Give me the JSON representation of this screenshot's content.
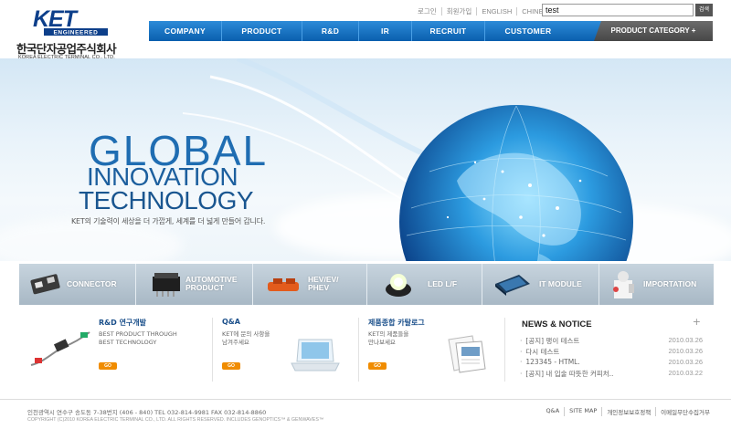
{
  "logo": {
    "mark_text": "KET",
    "mark_sub": "ENGINEERED",
    "company_ko": "한국단자공업주식회사",
    "company_en": "KOREA ELECTRIC TERMINAL CO., LTD."
  },
  "util_links": [
    "로그인",
    "회원가입",
    "ENGLISH",
    "CHINESE"
  ],
  "search": {
    "value": "test",
    "button": "검색"
  },
  "gnb": {
    "items": [
      "COMPANY",
      "PRODUCT",
      "R&D",
      "IR",
      "RECRUIT",
      "CUSTOMER"
    ],
    "product_category": "PRODUCT CATEGORY +"
  },
  "hero": {
    "line1": "GLOBAL",
    "line2": "INNOVATION",
    "line3": "TECHNOLOGY",
    "subtitle": "KET의 기술력이 세상을 더 가깝게, 세계를 더 넓게 만들어 갑니다."
  },
  "categories": [
    {
      "label": "CONNECTOR"
    },
    {
      "label": "AUTOMOTIVE",
      "label2": "PRODUCT"
    },
    {
      "label": "HEV/EV/",
      "label2": "PHEV"
    },
    {
      "label": "LED L/F"
    },
    {
      "label": "IT MODULE"
    },
    {
      "label": "IMPORTATION"
    }
  ],
  "boxes": {
    "rnd": {
      "title": "R&D 연구개발",
      "desc1": "BEST PRODUCT THROUGH",
      "desc2": "BEST TECHNOLOGY",
      "go": "GO"
    },
    "qna": {
      "title": "Q&A",
      "desc1": "KET에 문의 사항을",
      "desc2": "남겨주세요",
      "go": "GO"
    },
    "catalog": {
      "title": "제품종합 카탈로그",
      "desc1": "KET의 제품들을",
      "desc2": "만나보세요",
      "go": "GO"
    }
  },
  "news": {
    "title": "NEWS & NOTICE",
    "more": "+",
    "items": [
      {
        "text": "[공지] 팽이 테스트",
        "date": "2010.03.26"
      },
      {
        "text": "다시 테스트",
        "date": "2010.03.26"
      },
      {
        "text": "123345 - HTML.",
        "date": "2010.03.26"
      },
      {
        "text": "[공지] 내 입술 따뜻한 커피처..",
        "date": "2010.03.22"
      }
    ]
  },
  "footer": {
    "address": "인천광역시 연수구 송도동 7-38번지 (406 - 840) TEL 032-814-9981 FAX 032-814-8860",
    "copyright": "COPYRIGHT (C)2010 KOREA ELECTRIC TERMINAL CO., LTD. ALL RIGHTS RESERVED. INCLUDES GENOPTICS™ & GENWAVES™",
    "links": [
      "Q&A",
      "SITE MAP",
      "개인정보보호정책",
      "이메일무단수집거부"
    ]
  },
  "colors": {
    "nav_blue": "#0a5fae",
    "brand_blue": "#1f6db2",
    "accent_orange": "#f08c00",
    "category_gray": "#a8b8c5"
  }
}
